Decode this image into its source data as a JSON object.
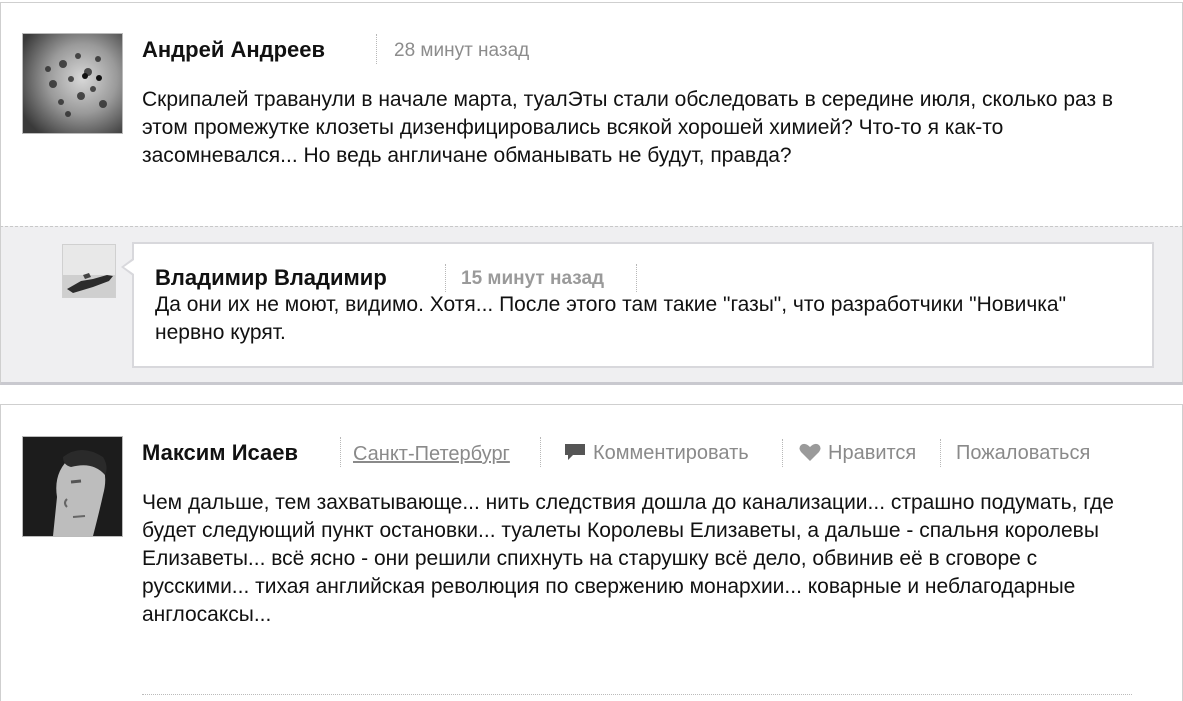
{
  "comments": [
    {
      "author": "Андрей Андреев",
      "time": "28 минут назад",
      "text": "Скрипалей траванули в начале марта, туалЭты стали обследовать в середине июля, сколько раз в этом промежутке клозеты дизенфицировались всякой хорошей химией? Что-то я как-то засомневался... Но ведь англичане обманывать не будут, правда?",
      "avatar_icon": "leopard-avatar-icon",
      "reply": {
        "author": "Владимир Владимир",
        "time": "15 минут назад",
        "text": "Да они их не моют, видимо. Хотя... После этого там такие \"газы\", что разработчики \"Новичка\" нервно курят.",
        "avatar_icon": "sniper-avatar-icon"
      }
    },
    {
      "author": "Максим Исаев",
      "city": "Санкт-Петербург",
      "actions": {
        "comment": "Комментировать",
        "like": "Нравится",
        "report": "Пожаловаться"
      },
      "text": "Чем дальше, тем захватывающе... нить следствия дошла до канализации... страшно подумать, где будет следующий пункт остановки... туалеты Королевы Елизаветы, а дальше - спальня королевы Елизаветы... всё ясно - они решили спихнуть на старушку всё дело, обвинив её в сговоре с русскими... тихая английская революция по свержению монархии... коварные и неблагодарные англосаксы...",
      "avatar_icon": "man-portrait-avatar-icon"
    }
  ],
  "colors": {
    "meta_gray": "#8c8c8c",
    "reply_bg": "#efeff1",
    "border": "#cfcfcf"
  }
}
